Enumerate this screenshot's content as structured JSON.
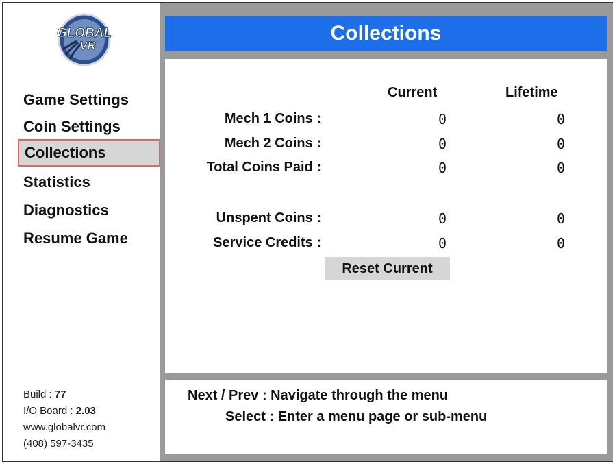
{
  "logo": {
    "text_top": "GLOBAL",
    "text_bottom": "VR"
  },
  "title": "Collections",
  "menu": [
    {
      "label": "Game Settings"
    },
    {
      "label": "Coin Settings"
    },
    {
      "label": "Collections",
      "selected": true
    },
    {
      "label": "Statistics"
    },
    {
      "label": "Diagnostics"
    },
    {
      "label": "Resume Game"
    }
  ],
  "footer": {
    "build_label": "Build : ",
    "build_value": "77",
    "io_label": "I/O Board : ",
    "io_value": "2.03",
    "website": "www.globalvr.com",
    "phone": "(408) 597-3435"
  },
  "table": {
    "headers": {
      "current": "Current",
      "lifetime": "Lifetime"
    },
    "rows": [
      {
        "label": "Mech 1 Coins :",
        "current": "0",
        "lifetime": "0"
      },
      {
        "label": "Mech 2 Coins :",
        "current": "0",
        "lifetime": "0"
      },
      {
        "label": "Total Coins Paid :",
        "current": "0",
        "lifetime": "0"
      },
      {
        "label": "Unspent Coins :",
        "current": "0",
        "lifetime": "0"
      },
      {
        "label": "Service Credits :",
        "current": "0",
        "lifetime": "0"
      }
    ]
  },
  "reset_button": "Reset Current",
  "help": [
    "Next / Prev : Navigate through the menu",
    "Select : Enter a menu page or sub-menu"
  ],
  "colors": {
    "title_bar": "#1c6fe8",
    "selection_border": "#e06666",
    "selection_fill": "#d6d6d6",
    "panel_bg": "#9a9a9a"
  }
}
